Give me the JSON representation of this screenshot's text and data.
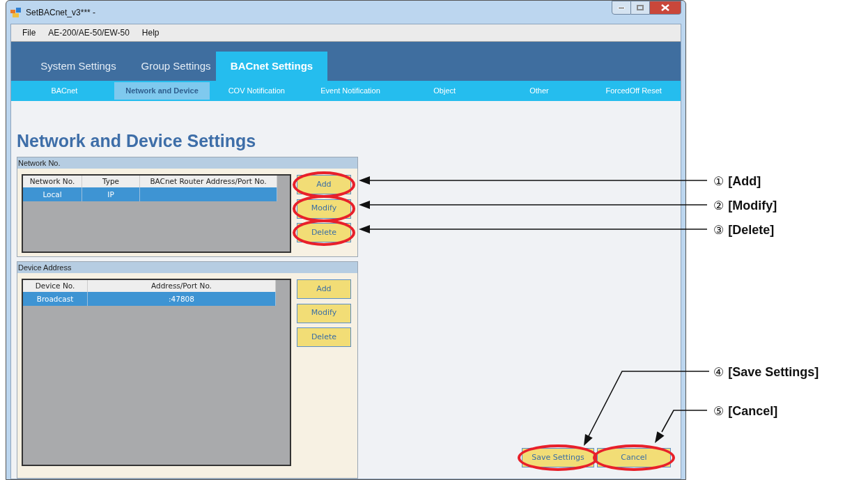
{
  "window": {
    "title": "SetBACnet_v3*** -"
  },
  "menu": [
    "File",
    "AE-200/AE-50/EW-50",
    "Help"
  ],
  "main_tabs": [
    {
      "label": "System Settings",
      "selected": false
    },
    {
      "label": "Group Settings",
      "selected": false
    },
    {
      "label": "BACnet Settings",
      "selected": true
    }
  ],
  "sub_tabs": [
    {
      "label": "BACnet",
      "selected": false
    },
    {
      "label": "Network and Device",
      "selected": true
    },
    {
      "label": "COV Notification",
      "selected": false
    },
    {
      "label": "Event Notification",
      "selected": false
    },
    {
      "label": "Object",
      "selected": false
    },
    {
      "label": "Other",
      "selected": false
    },
    {
      "label": "ForcedOff Reset",
      "selected": false
    }
  ],
  "heading": "Network and Device Settings",
  "groups": [
    {
      "title": "Network No.",
      "columns": [
        "Network No.",
        "Type",
        "BACnet Router Address/Port No."
      ],
      "rows": [
        {
          "cells": [
            "Local",
            "IP",
            ""
          ],
          "selected": true
        }
      ],
      "buttons": [
        {
          "label": "Add",
          "highlighted": true
        },
        {
          "label": "Modify",
          "highlighted": true
        },
        {
          "label": "Delete",
          "highlighted": true
        }
      ]
    },
    {
      "title": "Device Address",
      "columns": [
        "Device No.",
        "Address/Port No."
      ],
      "rows": [
        {
          "cells": [
            "Broadcast",
            ":47808"
          ],
          "selected": true
        }
      ],
      "buttons": [
        {
          "label": "Add",
          "highlighted": false
        },
        {
          "label": "Modify",
          "highlighted": false
        },
        {
          "label": "Delete",
          "highlighted": false
        }
      ]
    }
  ],
  "footer_buttons": [
    {
      "label": "Save Settings",
      "highlighted": true
    },
    {
      "label": "Cancel",
      "highlighted": true
    }
  ],
  "callouts": [
    {
      "number": "①",
      "label": "[Add]"
    },
    {
      "number": "②",
      "label": "[Modify]"
    },
    {
      "number": "③",
      "label": "[Delete]"
    },
    {
      "number": "④",
      "label": "[Save Settings]"
    },
    {
      "number": "⑤",
      "label": "[Cancel]"
    }
  ]
}
